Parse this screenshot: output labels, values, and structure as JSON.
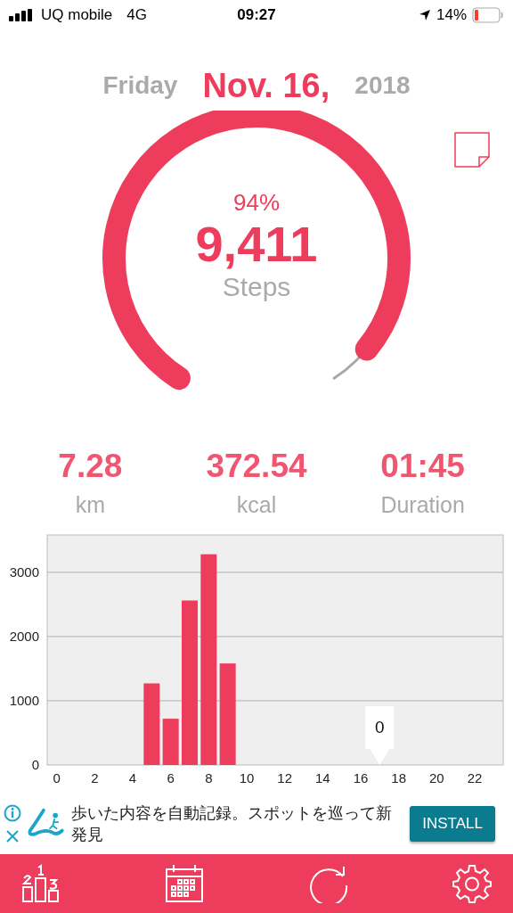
{
  "status_bar": {
    "carrier": "UQ mobile",
    "network": "4G",
    "time": "09:27",
    "battery": "14%"
  },
  "date": {
    "weekday": "Friday",
    "day": "Nov. 16,",
    "year": "2018"
  },
  "gauge": {
    "percent": "94%",
    "steps": "9,411",
    "unit": "Steps"
  },
  "stats": [
    {
      "value": "7.28",
      "label": "km"
    },
    {
      "value": "372.54",
      "label": "kcal"
    },
    {
      "value": "01:45",
      "label": "Duration"
    }
  ],
  "chart": {
    "chart_data": {
      "type": "bar",
      "x": [
        0,
        1,
        2,
        3,
        4,
        5,
        6,
        7,
        8,
        9,
        10,
        11,
        12,
        13,
        14,
        15,
        16,
        17,
        18,
        19,
        20,
        21,
        22,
        23
      ],
      "series": [
        {
          "color": "#ee3d5c",
          "values": [
            0,
            0,
            0,
            0,
            0,
            1270,
            720,
            2560,
            3280,
            1580,
            0,
            0,
            0,
            0,
            0,
            0,
            0,
            0,
            0,
            0,
            0,
            0,
            0,
            0
          ]
        }
      ],
      "xlim": [
        -0.5,
        23.5
      ],
      "ylim": [
        0,
        3580
      ],
      "yticks": [
        0,
        1000,
        2000,
        3000
      ],
      "xticks": [
        0,
        2,
        4,
        6,
        8,
        10,
        12,
        14,
        16,
        18,
        20,
        22
      ],
      "grid": true,
      "annotations": [
        {
          "x": 17,
          "y": 0,
          "text": "0"
        }
      ]
    }
  },
  "ad": {
    "text": "歩いた内容を自動記録。スポットを巡って新発見",
    "button": "INSTALL"
  }
}
